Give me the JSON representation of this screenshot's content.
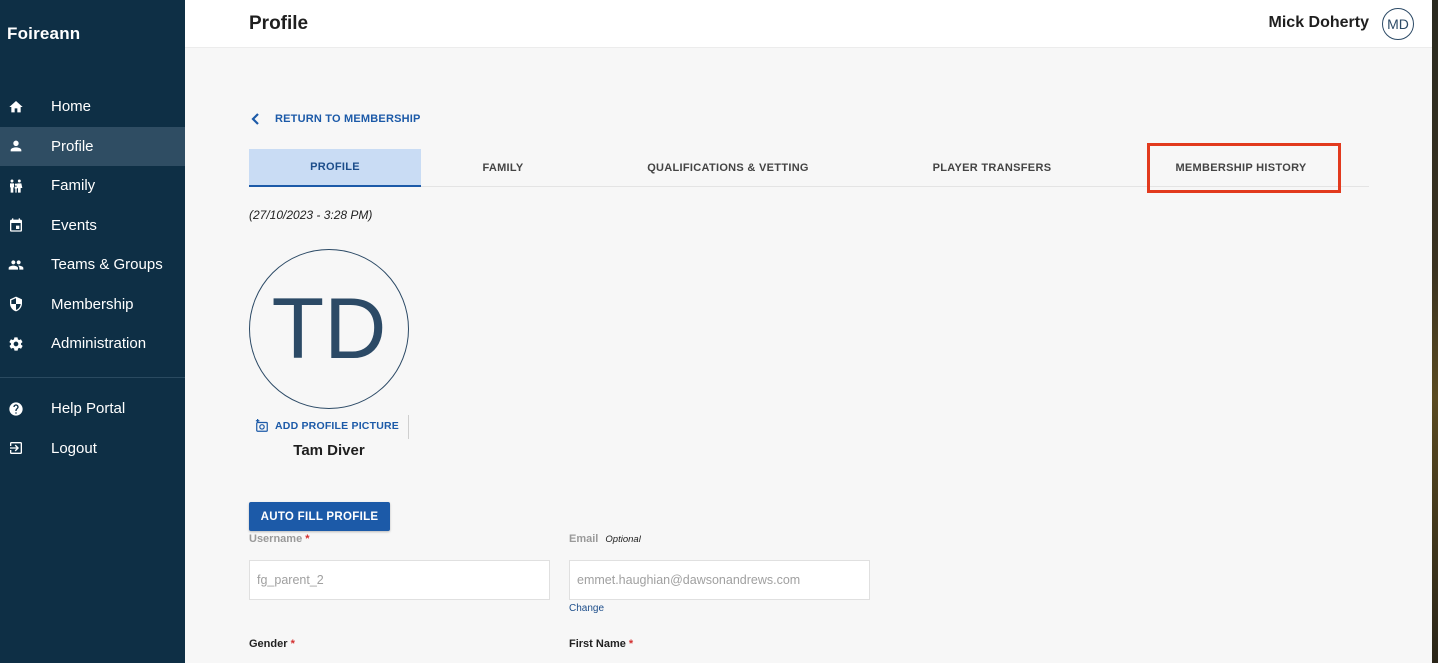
{
  "app": {
    "brand": "Foireann"
  },
  "sidebar": {
    "items": [
      {
        "label": "Home",
        "icon": "home-icon"
      },
      {
        "label": "Profile",
        "icon": "person-icon",
        "active": true
      },
      {
        "label": "Family",
        "icon": "family-icon"
      },
      {
        "label": "Events",
        "icon": "calendar-icon"
      },
      {
        "label": "Teams & Groups",
        "icon": "group-icon"
      },
      {
        "label": "Membership",
        "icon": "shield-icon"
      },
      {
        "label": "Administration",
        "icon": "gear-icon"
      }
    ],
    "secondary": [
      {
        "label": "Help Portal",
        "icon": "help-icon"
      },
      {
        "label": "Logout",
        "icon": "logout-icon"
      }
    ]
  },
  "header": {
    "title": "Profile",
    "user_name": "Mick Doherty",
    "user_initials": "MD"
  },
  "back_link": "RETURN TO MEMBERSHIP",
  "tabs": [
    {
      "label": "PROFILE",
      "active": true
    },
    {
      "label": "FAMILY"
    },
    {
      "label": "QUALIFICATIONS & VETTING"
    },
    {
      "label": "PLAYER TRANSFERS"
    },
    {
      "label": "MEMBERSHIP HISTORY",
      "highlighted": true
    }
  ],
  "profile": {
    "timestamp": "(27/10/2023 - 3:28 PM)",
    "initials": "TD",
    "add_picture": "ADD PROFILE PICTURE",
    "name": "Tam Diver",
    "autofill_button": "AUTO FILL PROFILE"
  },
  "form": {
    "username_label": "Username",
    "username_value": "fg_parent_2",
    "email_label": "Email",
    "email_optional": "Optional",
    "email_value": "emmet.haughian@dawsonandrews.com",
    "change_link": "Change",
    "gender_label": "Gender",
    "first_name_label": "First Name",
    "required_mark": "*"
  },
  "colors": {
    "sidebar_bg": "#0e2f45",
    "sidebar_active": "#2f4d63",
    "accent": "#1c5aa8",
    "highlight_box": "#e23a1e",
    "active_tab_bg": "#c9dcf4"
  }
}
